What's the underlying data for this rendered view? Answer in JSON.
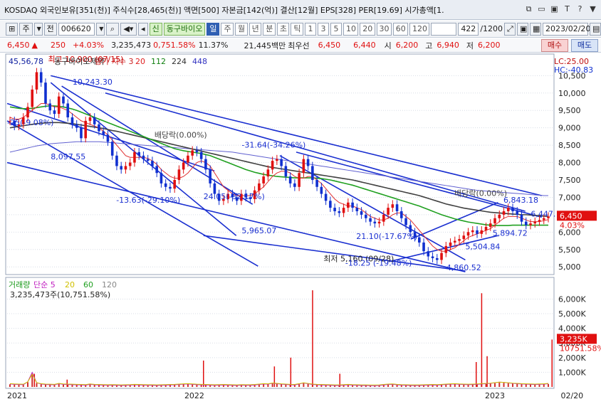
{
  "titlebar": {
    "text": "KOSDAQ 외국인보유[351(천)] 주식수[28,465(천)] 액면[500] 자본금[142(억)] 결산[12월] EPS[328] PER[19.69] 시가총액[1.",
    "icons": [
      "restore-icon",
      "minimize-icon",
      "maximize-icon",
      "text-icon",
      "help-icon",
      "close-icon"
    ],
    "icon_glyphs": [
      "⧉",
      "▭",
      "▣",
      "T",
      "?",
      "▼"
    ]
  },
  "toolbar": {
    "mode": "주",
    "mode2": "전",
    "code": "006620",
    "tag": "신",
    "name": "동구바이오",
    "flag": "일",
    "periods": [
      "주",
      "월",
      "년",
      "분",
      "초",
      "틱"
    ],
    "minutes": [
      "1",
      "3",
      "5",
      "10",
      "20",
      "30",
      "60",
      "120"
    ],
    "count": "422",
    "count_total": "/1200",
    "date": "2023/02/20"
  },
  "pricebar": {
    "price": "6,450",
    "arrow": "▲",
    "change": "250",
    "rate": "+4.03%",
    "volume": "3,235,473",
    "vol_ratio": "0,751.58%",
    "turnover": "11.37%",
    "amount": "21,445백만",
    "best_ask_label": "최우선",
    "best_ask": "6,450",
    "best_bid": "6,440",
    "open_label": "시",
    "open": "6,200",
    "high_label": "고",
    "high": "6,940",
    "low_label": "저",
    "low": "6,200",
    "buy": "매수",
    "sell": "매도"
  },
  "chart_data": {
    "type": "candlestick",
    "price_panel": {
      "legend_items": [
        "45,56,78",
        "동구바이오제약",
        "종가 지수 3",
        "20",
        "112",
        "224",
        "448"
      ],
      "legend_colors": [
        "#1020a0",
        "#222222",
        "#cc2222",
        "#e02020",
        "#108010",
        "#303030",
        "#3030c0"
      ],
      "lc_label": "LC:25.00",
      "hc_label": "HC:-40.83",
      "y_ticks": [
        10500,
        10000,
        9500,
        9000,
        8500,
        8000,
        7500,
        7000,
        6500,
        6000,
        5500,
        5000
      ],
      "y_tick_labels": [
        "10,500",
        "10,000",
        "9,500",
        "9,000",
        "8,500",
        "8,000",
        "7,500",
        "7,000",
        "6,500",
        "6,000",
        "5,500",
        "5,000"
      ],
      "ylim": [
        4820,
        11080
      ],
      "current_price": "6,450",
      "current_rate": "4.03%",
      "annotations": [
        "최고 10,900 (07/15)",
        "10,243.30",
        "-25(-9.08%)",
        "8,097.55",
        "배당락(0.00%)",
        "-31.64(-34.26%)",
        "-13.63(-29.10%)",
        "24.05(-32.17%)",
        "5,965.07",
        "21.10(-17.67%)",
        "최저 5,160 (09/28)",
        "-18.25 (-19.48%)",
        "-4,860.52",
        "배당락(0.00%)",
        "6,843.18",
        "6,447.",
        "5,894.72",
        "5,504.84"
      ],
      "closes": [
        9200,
        9050,
        9100,
        9300,
        9600,
        10100,
        10600,
        10300,
        9700,
        9500,
        9400,
        9900,
        9700,
        9300,
        9100,
        9000,
        8700,
        9200,
        9300,
        9100,
        8900,
        8800,
        8600,
        8200,
        7900,
        7800,
        7900,
        8000,
        8300,
        8200,
        8100,
        8050,
        7900,
        7700,
        7400,
        7300,
        7250,
        7500,
        7800,
        8000,
        8200,
        8350,
        8300,
        8100,
        7800,
        7400,
        7100,
        6900,
        6950,
        7100,
        7000,
        6900,
        7100,
        7000,
        6950,
        7200,
        7400,
        7600,
        7800,
        8050,
        8100,
        7900,
        7600,
        7400,
        7300,
        7700,
        8100,
        7900,
        7500,
        7300,
        7100,
        6900,
        6700,
        6600,
        6550,
        6700,
        6850,
        6700,
        6600,
        6500,
        6400,
        6300,
        6250,
        6300,
        6500,
        6700,
        6800,
        6600,
        6400,
        6200,
        6000,
        5850,
        5700,
        5450,
        5300,
        5250,
        5200,
        5400,
        5600,
        5700,
        5750,
        5800,
        5900,
        6000,
        6050,
        5950,
        6050,
        6150,
        6250,
        6400,
        6500,
        6600,
        6700,
        6600,
        6500,
        6300,
        6200,
        6250,
        6300,
        6350,
        6400,
        6450
      ],
      "ma20": [
        9300,
        9250,
        9250,
        9300,
        9400,
        9500,
        9600,
        9700,
        9700,
        9650,
        9600,
        9600,
        9550,
        9500,
        9400,
        9300,
        9200,
        9150,
        9100,
        9050,
        9000,
        8900,
        8800,
        8650,
        8500,
        8350,
        8200,
        8150,
        8150,
        8150,
        8150,
        8120,
        8050,
        7950,
        7800,
        7700,
        7600,
        7550,
        7550,
        7600,
        7700,
        7850,
        8000,
        8050,
        8000,
        7900,
        7700,
        7500,
        7300,
        7200,
        7100,
        7050,
        7050,
        7050,
        7050,
        7100,
        7200,
        7300,
        7450,
        7600,
        7700,
        7750,
        7750,
        7700,
        7600,
        7550,
        7550,
        7600,
        7600,
        7500,
        7400,
        7250,
        7100,
        6950,
        6850,
        6800,
        6750,
        6750,
        6700,
        6650,
        6550,
        6450,
        6400,
        6350,
        6350,
        6400,
        6500,
        6550,
        6550,
        6450,
        6350,
        6200,
        6050,
        5900,
        5750,
        5600,
        5500,
        5450,
        5450,
        5500,
        5550,
        5650,
        5750,
        5850,
        5900,
        5950,
        6000,
        6050,
        6100,
        6200,
        6300,
        6400,
        6450,
        6450,
        6450,
        6400,
        6350,
        6300,
        6300,
        6300,
        6330,
        6360
      ],
      "ma112": [
        9600,
        9580,
        9560,
        9550,
        9550,
        9560,
        9580,
        9600,
        9620,
        9630,
        9630,
        9620,
        9600,
        9570,
        9540,
        9500,
        9450,
        9400,
        9350,
        9300,
        9250,
        9200,
        9150,
        9100,
        9050,
        9000,
        8950,
        8900,
        8850,
        8800,
        8750,
        8700,
        8650,
        8600,
        8550,
        8500,
        8450,
        8400,
        8370,
        8340,
        8320,
        8300,
        8280,
        8260,
        8230,
        8200,
        8150,
        8100,
        8050,
        8000,
        7950,
        7900,
        7850,
        7800,
        7760,
        7720,
        7690,
        7660,
        7640,
        7620,
        7600,
        7590,
        7580,
        7570,
        7560,
        7560,
        7560,
        7560,
        7560,
        7550,
        7540,
        7520,
        7500,
        7470,
        7440,
        7410,
        7380,
        7350,
        7310,
        7270,
        7230,
        7190,
        7150,
        7110,
        7070,
        7030,
        6990,
        6950,
        6910,
        6870,
        6830,
        6790,
        6750,
        6700,
        6650,
        6600,
        6550,
        6500,
        6460,
        6420,
        6380,
        6350,
        6320,
        6290,
        6270,
        6250,
        6230,
        6210,
        6200,
        6190,
        6190,
        6190,
        6190,
        6200,
        6200,
        6200,
        6200,
        6200,
        6200,
        6200,
        6200,
        6200
      ],
      "ma224": [
        9000,
        9020,
        9040,
        9060,
        9080,
        9100,
        9120,
        9130,
        9140,
        9150,
        9150,
        9150,
        9140,
        9130,
        9120,
        9100,
        9080,
        9060,
        9040,
        9020,
        9000,
        8980,
        8950,
        8920,
        8900,
        8870,
        8840,
        8810,
        8780,
        8750,
        8720,
        8690,
        8660,
        8630,
        8600,
        8570,
        8540,
        8510,
        8480,
        8450,
        8420,
        8390,
        8360,
        8330,
        8300,
        8270,
        8240,
        8210,
        8180,
        8150,
        8120,
        8090,
        8060,
        8030,
        8000,
        7970,
        7940,
        7910,
        7880,
        7860,
        7840,
        7820,
        7800,
        7780,
        7760,
        7740,
        7720,
        7700,
        7680,
        7660,
        7640,
        7620,
        7600,
        7580,
        7560,
        7540,
        7520,
        7500,
        7470,
        7440,
        7410,
        7380,
        7350,
        7320,
        7290,
        7260,
        7230,
        7200,
        7170,
        7140,
        7110,
        7080,
        7050,
        7010,
        6970,
        6930,
        6890,
        6850,
        6810,
        6780,
        6750,
        6720,
        6690,
        6670,
        6650,
        6630,
        6610,
        6590,
        6570,
        6560,
        6550,
        6540,
        6530,
        6520,
        6510,
        6500,
        6500,
        6490,
        6480,
        6470,
        6460,
        6450
      ],
      "ma448": [
        8300,
        8330,
        8360,
        8390,
        8420,
        8450,
        8480,
        8500,
        8520,
        8540,
        8550,
        8560,
        8570,
        8580,
        8590,
        8600,
        8600,
        8600,
        8600,
        8600,
        8600,
        8590,
        8580,
        8570,
        8560,
        8550,
        8540,
        8530,
        8520,
        8510,
        8500,
        8490,
        8480,
        8470,
        8460,
        8450,
        8440,
        8430,
        8420,
        8410,
        8400,
        8390,
        8380,
        8370,
        8360,
        8350,
        8340,
        8330,
        8320,
        8310,
        8300,
        8280,
        8260,
        8240,
        8220,
        8200,
        8180,
        8160,
        8140,
        8120,
        8100,
        8080,
        8060,
        8040,
        8020,
        8000,
        7980,
        7960,
        7940,
        7920,
        7900,
        7880,
        7860,
        7840,
        7820,
        7800,
        7780,
        7760,
        7740,
        7720,
        7700,
        7680,
        7660,
        7640,
        7620,
        7600,
        7580,
        7560,
        7540,
        7520,
        7500,
        7480,
        7460,
        7440,
        7420,
        7400,
        7380,
        7360,
        7340,
        7320,
        7300,
        7280,
        7260,
        7240,
        7220,
        7200,
        7190,
        7180,
        7170,
        7160,
        7150,
        7140,
        7130,
        7120,
        7110,
        7100,
        7090,
        7080,
        7070,
        7060,
        7050,
        7050
      ]
    },
    "volume_panel": {
      "legend_items": [
        "거래량",
        "단순 5",
        "20",
        "60",
        "120"
      ],
      "legend_colors": [
        "#1a9a1a",
        "#c020c0",
        "#d0c000",
        "#20a020",
        "#888888"
      ],
      "value_label": "3,235,473주(10,751.58%)",
      "y_ticks": [
        6000000,
        5000000,
        4000000,
        3000000,
        2000000,
        1000000
      ],
      "y_tick_labels": [
        "6,000K",
        "5,000K",
        "4,000K",
        "3,000K",
        "2,000K",
        "1,000K"
      ],
      "ylim": [
        0,
        6800000
      ],
      "current_label": "3,235K",
      "current_rate": "10751.58%",
      "spikes": [
        [
          0.05,
          900000
        ],
        [
          0.11,
          500000
        ],
        [
          0.36,
          1800000
        ],
        [
          0.49,
          1400000
        ],
        [
          0.52,
          2000000
        ],
        [
          0.56,
          6600000
        ],
        [
          0.61,
          900000
        ],
        [
          0.86,
          1700000
        ],
        [
          0.87,
          6400000
        ],
        [
          0.88,
          2100000
        ],
        [
          0.999,
          3235473
        ]
      ],
      "volumes": [
        180,
        160,
        150,
        140,
        320,
        900,
        260,
        180,
        150,
        140,
        130,
        200,
        160,
        150,
        140,
        130,
        120,
        110,
        160,
        130,
        120,
        110,
        100,
        110,
        100,
        90,
        100,
        110,
        130,
        120,
        110,
        100,
        100,
        90,
        100,
        110,
        120,
        130,
        150,
        170,
        180,
        160,
        140,
        130,
        120,
        110,
        100,
        110,
        120,
        110,
        100,
        90,
        110,
        100,
        100,
        120,
        150,
        180,
        170,
        230,
        200,
        170,
        150,
        130,
        120,
        180,
        250,
        200,
        150,
        130,
        120,
        110,
        100,
        90,
        90,
        110,
        130,
        110,
        100,
        90,
        90,
        80,
        80,
        90,
        120,
        150,
        160,
        130,
        110,
        100,
        90,
        90,
        90,
        100,
        110,
        120,
        110,
        130,
        150,
        170,
        180,
        160,
        150,
        140,
        150,
        160,
        180,
        200,
        220,
        260,
        300,
        280,
        250,
        220,
        200,
        180,
        170,
        160,
        150,
        160,
        170,
        200
      ]
    },
    "x_ticks": [
      "2021",
      "2022",
      "2023",
      "02/20"
    ]
  }
}
